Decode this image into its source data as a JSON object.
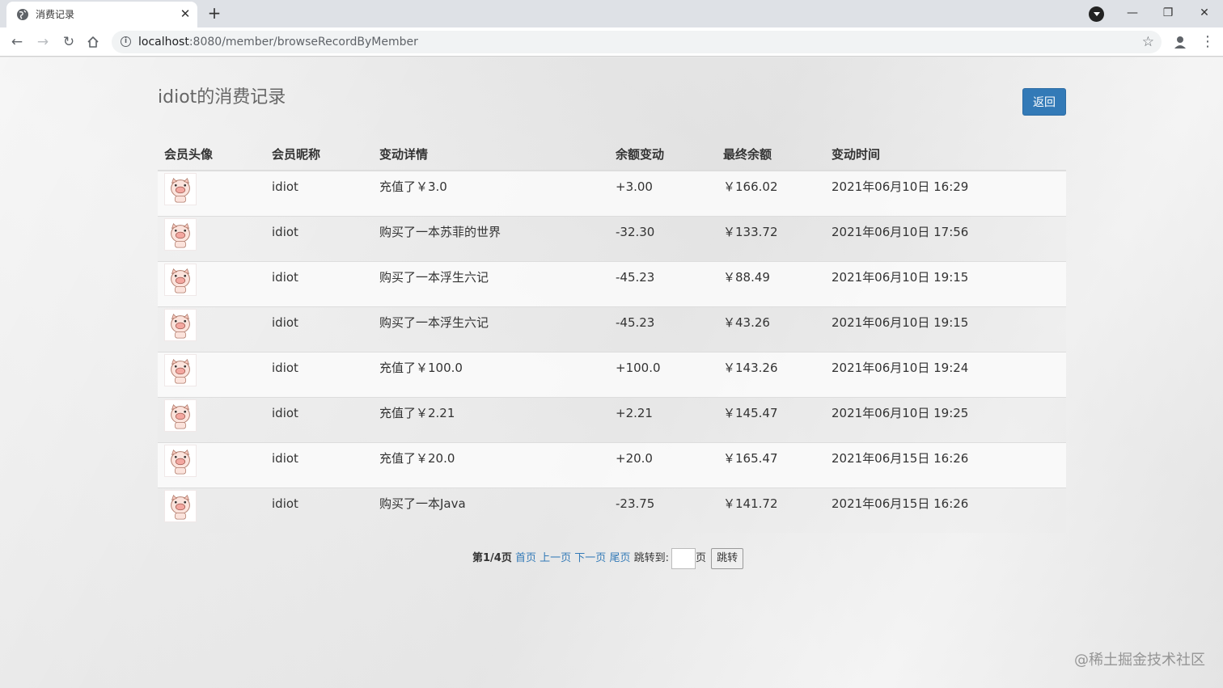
{
  "browser": {
    "tab_title": "消费记录",
    "url_host": "localhost",
    "url_port_path": ":8080/member/browseRecordByMember"
  },
  "page": {
    "title": "idiot的消费记录",
    "back_label": "返回"
  },
  "table": {
    "headers": [
      "会员头像",
      "会员昵称",
      "变动详情",
      "余额变动",
      "最终余额",
      "变动时间"
    ],
    "rows": [
      {
        "nickname": "idiot",
        "detail": "充值了￥3.0",
        "change": "+3.00",
        "balance": "￥166.02",
        "time": "2021年06月10日 16:29"
      },
      {
        "nickname": "idiot",
        "detail": "购买了一本苏菲的世界",
        "change": "-32.30",
        "balance": "￥133.72",
        "time": "2021年06月10日 17:56"
      },
      {
        "nickname": "idiot",
        "detail": "购买了一本浮生六记",
        "change": "-45.23",
        "balance": "￥88.49",
        "time": "2021年06月10日 19:15"
      },
      {
        "nickname": "idiot",
        "detail": "购买了一本浮生六记",
        "change": "-45.23",
        "balance": "￥43.26",
        "time": "2021年06月10日 19:15"
      },
      {
        "nickname": "idiot",
        "detail": "充值了￥100.0",
        "change": "+100.0",
        "balance": "￥143.26",
        "time": "2021年06月10日 19:24"
      },
      {
        "nickname": "idiot",
        "detail": "充值了￥2.21",
        "change": "+2.21",
        "balance": "￥145.47",
        "time": "2021年06月10日 19:25"
      },
      {
        "nickname": "idiot",
        "detail": "充值了￥20.0",
        "change": "+20.0",
        "balance": "￥165.47",
        "time": "2021年06月15日 16:26"
      },
      {
        "nickname": "idiot",
        "detail": "购买了一本Java",
        "change": "-23.75",
        "balance": "￥141.72",
        "time": "2021年06月15日 16:26"
      }
    ]
  },
  "pager": {
    "current": "第1/4页",
    "first": "首页",
    "prev": "上一页",
    "next": "下一页",
    "last": "尾页",
    "jump_to": "跳转到:",
    "page_unit": "页",
    "jump_button": "跳转"
  },
  "watermark": "@稀土掘金技术社区",
  "colors": {
    "primary": "#337ab7",
    "link": "#337ab7"
  },
  "icons": {
    "tab_favicon": "globe-icon",
    "tab_close": "close-icon",
    "new_tab": "plus-icon",
    "extension": "chevron-down-circle-icon",
    "back": "arrow-left-icon",
    "forward": "arrow-right-icon",
    "reload": "reload-icon",
    "home": "home-icon",
    "site_info": "info-icon",
    "bookmark": "star-icon",
    "profile": "person-icon",
    "menu": "kebab-menu-icon",
    "avatar": "pig-avatar"
  }
}
